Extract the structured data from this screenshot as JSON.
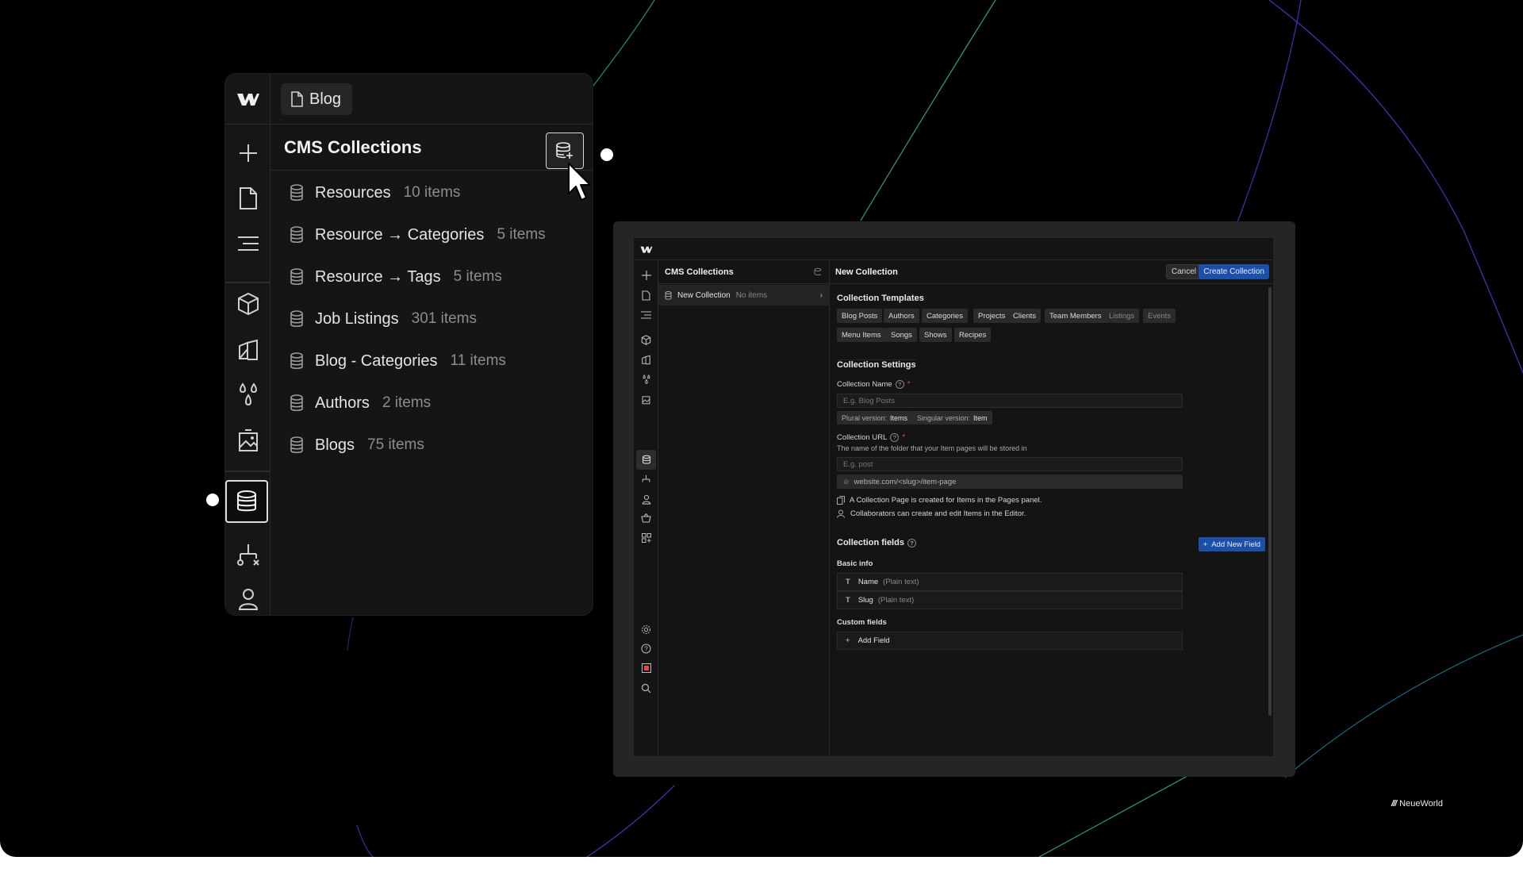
{
  "brand": {
    "name": "NeueWorld",
    "logo_glyph": "///"
  },
  "large_panel": {
    "page_chip": "Blog",
    "title": "CMS Collections",
    "collections": [
      {
        "name": "Resources",
        "count": "10 items"
      },
      {
        "name": "Resource → Categories",
        "count": "5 items"
      },
      {
        "name": "Resource → Tags",
        "count": "5 items"
      },
      {
        "name": "Job Listings",
        "count": "301 items"
      },
      {
        "name": "Blog - Categories",
        "count": "11 items"
      },
      {
        "name": "Authors",
        "count": "2 items"
      },
      {
        "name": "Blogs",
        "count": "75 items"
      }
    ],
    "rail_icons": [
      "plus-icon",
      "page-icon",
      "navigator-icon",
      "components-icon",
      "style-guide-icon",
      "variables-icon",
      "assets-icon",
      "cms-database-icon",
      "logic-icon",
      "users-icon"
    ]
  },
  "editor": {
    "collections_title": "CMS Collections",
    "new_collection_item": {
      "name": "New Collection",
      "count": "No items"
    },
    "main_title": "New Collection",
    "cancel_label": "Cancel",
    "create_label": "Create Collection",
    "templates_title": "Collection Templates",
    "templates_row1": [
      "Blog Posts",
      "Authors",
      "Categories",
      "Projects",
      "Clients",
      "Team Members",
      "Listings",
      "Events"
    ],
    "templates_row2": [
      "Menu Items",
      "Songs",
      "Shows",
      "Recipes"
    ],
    "settings_title": "Collection Settings",
    "name_label": "Collection Name",
    "name_placeholder": "E.g. Blog Posts",
    "plural_label": "Plural version:",
    "plural_value": "Items",
    "singular_label": "Singular version:",
    "singular_value": "Item",
    "url_label": "Collection URL",
    "url_help": "The name of the folder that your Item pages will be stored in",
    "url_placeholder": "E.g. post",
    "url_preview": "website.com/<slug>/item-page",
    "note_pages": "A Collection Page is created for Items in the Pages panel.",
    "note_collab": "Collaborators can create and edit Items in the Editor.",
    "fields_title": "Collection fields",
    "add_new_field_label": "Add New Field",
    "basic_info_label": "Basic info",
    "basic_fields": [
      {
        "name": "Name",
        "type": "(Plain text)"
      },
      {
        "name": "Slug",
        "type": "(Plain text)"
      }
    ],
    "custom_fields_label": "Custom fields",
    "add_field_label": "Add Field"
  },
  "colors": {
    "accent_blue": "#1b4fa8",
    "required_red": "#e04848",
    "background": "#000000"
  }
}
